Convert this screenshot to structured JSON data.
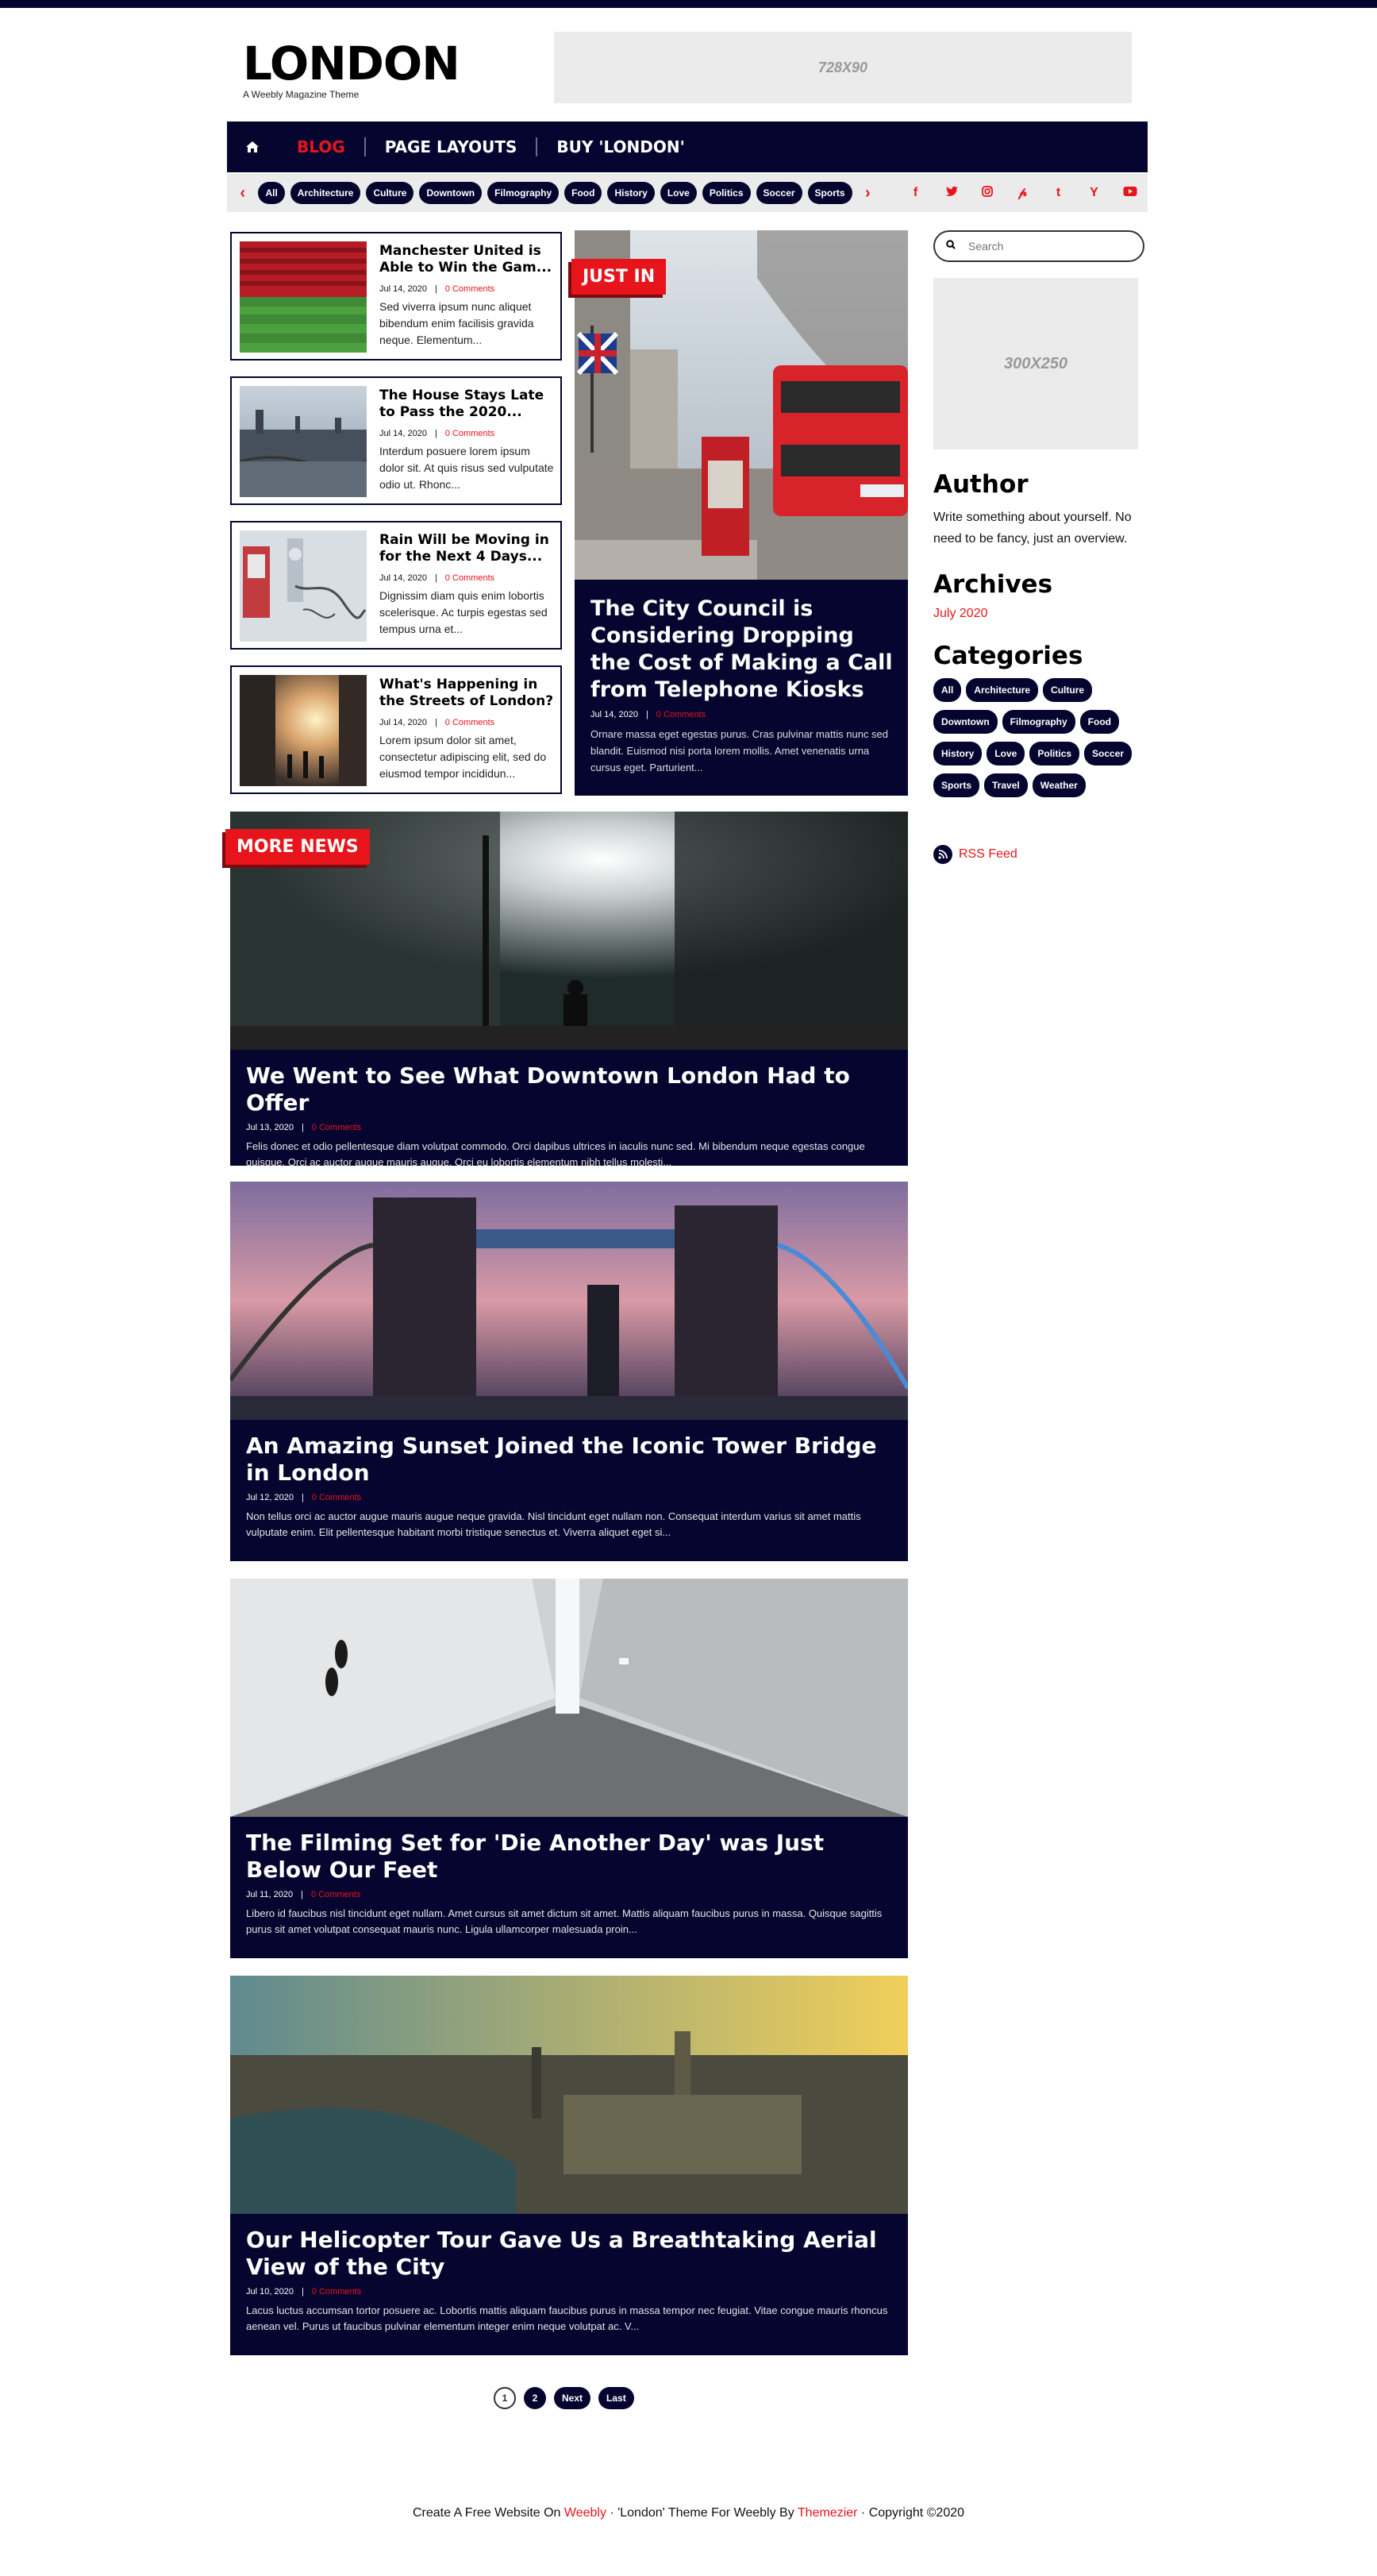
{
  "site": {
    "title": "LONDON",
    "tagline": "A Weebly Magazine Theme"
  },
  "ads": {
    "top": "728X90",
    "side": "300X250"
  },
  "nav": {
    "items": [
      {
        "label": "BLOG"
      },
      {
        "label": "PAGE LAYOUTS"
      },
      {
        "label": "BUY 'LONDON'"
      }
    ]
  },
  "tags": [
    "All",
    "Architecture",
    "Culture",
    "Downtown",
    "Filmography",
    "Food",
    "History",
    "Love",
    "Politics",
    "Soccer",
    "Sports"
  ],
  "social_icons": [
    "facebook-icon",
    "twitter-icon",
    "instagram-icon",
    "pinterest-icon",
    "tumblr-icon",
    "yahoo-icon",
    "youtube-icon"
  ],
  "small_posts": [
    {
      "title": "Manchester United is Able to Win the Gam...",
      "date": "Jul 14, 2020",
      "comments": "0 Comments",
      "excerpt": "Sed viverra ipsum nunc aliquet bibendum enim facilisis gravida neque. Elementum..."
    },
    {
      "title": "The House Stays Late to Pass the 2020...",
      "date": "Jul 14, 2020",
      "comments": "0 Comments",
      "excerpt": "Interdum posuere lorem ipsum dolor sit. At quis risus sed vulputate odio ut. Rhonc..."
    },
    {
      "title": "Rain Will be Moving in for the Next 4 Days...",
      "date": "Jul 14, 2020",
      "comments": "0 Comments",
      "excerpt": "Dignissim diam quis enim lobortis scelerisque. Ac turpis egestas sed tempus urna et..."
    },
    {
      "title": "What's Happening in the Streets of London?",
      "date": "Jul 14, 2020",
      "comments": "0 Comments",
      "excerpt": "Lorem ipsum dolor sit amet, consectetur adipiscing elit, sed do eiusmod tempor incididun..."
    }
  ],
  "just_in": {
    "label": "JUST IN",
    "title": "The City Council is Considering Dropping the Cost of Making a Call from Telephone Kiosks",
    "date": "Jul 14, 2020",
    "comments": "0 Comments",
    "excerpt": "Ornare massa eget egestas purus. Cras pulvinar mattis nunc sed blandit. Euismod nisi porta lorem mollis. Amet venenatis urna cursus eget. Parturient..."
  },
  "more_news_label": "MORE NEWS",
  "big_posts": [
    {
      "title": "We Went to See What Downtown London Had to Offer",
      "date": "Jul 13, 2020",
      "comments": "0 Comments",
      "excerpt": "Felis donec et odio pellentesque diam volutpat commodo. Orci dapibus ultrices in iaculis nunc sed. Mi bibendum neque egestas congue quisque. Orci ac auctor augue mauris augue. Orci eu lobortis elementum nibh tellus molesti..."
    },
    {
      "title": "An Amazing Sunset Joined the Iconic Tower Bridge in London",
      "date": "Jul 12, 2020",
      "comments": "0 Comments",
      "excerpt": "Non tellus orci ac auctor augue mauris augue neque gravida. Nisl tincidunt eget nullam non. Consequat interdum varius sit amet mattis vulputate enim. Elit pellentesque habitant morbi tristique senectus et. Viverra aliquet eget si..."
    },
    {
      "title": "The Filming Set for 'Die Another Day' was Just Below Our Feet",
      "date": "Jul 11, 2020",
      "comments": "0 Comments",
      "excerpt": "Libero id faucibus nisl tincidunt eget nullam. Amet cursus sit amet dictum sit amet. Mattis aliquam faucibus purus in massa. Quisque sagittis purus sit amet volutpat consequat mauris nunc. Ligula ullamcorper malesuada proin..."
    },
    {
      "title": "Our Helicopter Tour Gave Us a Breathtaking Aerial View of the City",
      "date": "Jul 10, 2020",
      "comments": "0 Comments",
      "excerpt": "Lacus luctus accumsan tortor posuere ac. Lobortis mattis aliquam faucibus purus in massa tempor nec feugiat. Vitae congue mauris rhoncus aenean vel. Purus ut faucibus pulvinar elementum integer enim neque volutpat ac. V..."
    }
  ],
  "sidebar": {
    "search_placeholder": "Search",
    "author_heading": "Author",
    "author_text": "Write something about yourself. No need to be fancy, just an overview.",
    "archives_heading": "Archives",
    "archive_link": "July 2020",
    "categories_heading": "Categories",
    "categories": [
      "All",
      "Architecture",
      "Culture",
      "Downtown",
      "Filmography",
      "Food",
      "History",
      "Love",
      "Politics",
      "Soccer",
      "Sports",
      "Travel",
      "Weather"
    ],
    "rss": "RSS Feed"
  },
  "pagination": {
    "pages": [
      "1",
      "2"
    ],
    "next": "Next",
    "last": "Last"
  },
  "footer": {
    "prefix": "Create A Free Website On",
    "weebly": "Weebly",
    "mid": "'London' Theme For Weebly By",
    "themezier": "Themezier",
    "copyright": "Copyright ©2020",
    "dot": "·"
  }
}
